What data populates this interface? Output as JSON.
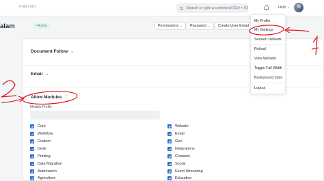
{
  "navbar": {
    "email_fragment": "mail.com",
    "search_placeholder": "Search or type a command (Ctrl + G)",
    "help_label": "Help",
    "icons": [
      "search-icon",
      "bell-icon",
      "chevron-down-icon",
      "avatar"
    ]
  },
  "page": {
    "title": "alam",
    "status": "Active",
    "buttons": {
      "permissions": "Permissions",
      "password": "Password",
      "create_user_email": "Create User Email"
    }
  },
  "sections": {
    "document_follow": "Document Follow",
    "email": "Email",
    "allow_modules": "Allow Modules",
    "module_profile_label": "Module Profile"
  },
  "modules": {
    "left": [
      "Core",
      "Workflow",
      "Custom",
      "Desk",
      "Printing",
      "Data Migration",
      "Automation",
      "Agriculture"
    ],
    "right": [
      "Website",
      "Email",
      "Geo",
      "Integrations",
      "Contacts",
      "Social",
      "Event Streaming",
      "Education"
    ]
  },
  "user_menu": {
    "my_profile": "My Profile",
    "my_settings": "My Settings",
    "session_defaults": "Session Defaults",
    "reload": "Reload",
    "view_website": "View Website",
    "toggle_full_width": "Toggle Full Width",
    "background_jobs": "Background Jobs",
    "logout": "Logout"
  },
  "colors": {
    "accent": "#2f6fd0",
    "active_green": "#2f9d58",
    "annotation_red": "#e0141e"
  }
}
